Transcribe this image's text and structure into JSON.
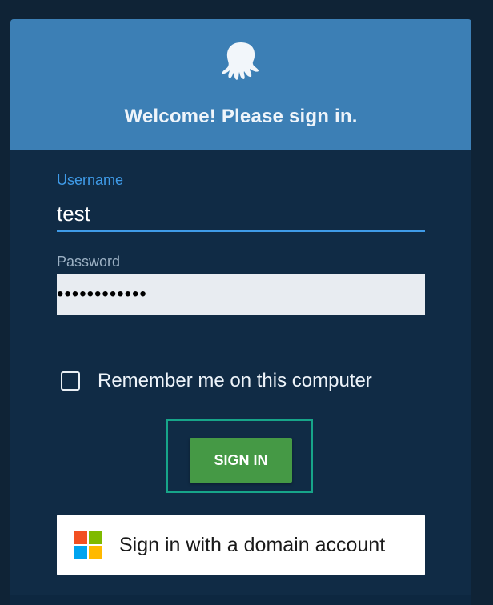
{
  "header": {
    "logo_icon": "octopus-logo-icon",
    "welcome_text": "Welcome! Please sign in."
  },
  "form": {
    "username": {
      "label": "Username",
      "value": "test"
    },
    "password": {
      "label": "Password",
      "value": "••••••••••••"
    },
    "remember_me": {
      "label": "Remember me on this computer",
      "checked": false
    },
    "sign_in_label": "SIGN IN",
    "domain_sign_in_label": "Sign in with a domain account"
  },
  "colors": {
    "header_bg": "#3c7fb5",
    "card_bg": "#102b45",
    "accent_blue": "#3f9be8",
    "sign_in_green": "#459945",
    "focus_teal": "#17a589",
    "ms_red": "#f25022",
    "ms_green": "#7fba00",
    "ms_blue": "#00a4ef",
    "ms_yellow": "#ffb900"
  }
}
